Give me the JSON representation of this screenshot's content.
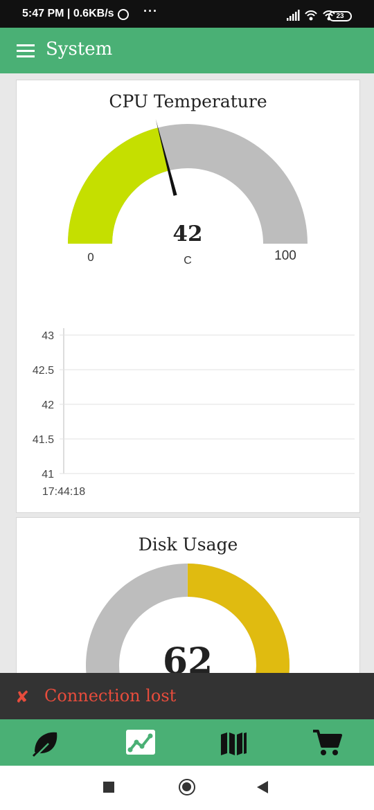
{
  "status_bar": {
    "time": "5:47 PM | 0.6KB/s",
    "dots": "···",
    "battery": "23",
    "icons": [
      "alarm-icon",
      "signal-icon",
      "wifi-icon",
      "battery-icon"
    ]
  },
  "app_bar": {
    "title": "System",
    "menu_icon": "hamburger-menu-icon"
  },
  "cpu": {
    "title": "CPU Temperature",
    "gauge": {
      "value": 42,
      "value_label": "42",
      "min": 0,
      "max": 100,
      "min_label": "0",
      "max_label": "100",
      "unit": "C",
      "fill_color": "#c5df00",
      "track_color": "#bdbdbd"
    }
  },
  "chart_data": {
    "type": "line",
    "title": "",
    "xlabel": "",
    "ylabel": "",
    "ylim": [
      41,
      43
    ],
    "y_ticks": [
      "43",
      "42.5",
      "42",
      "41.5",
      "41"
    ],
    "x_ticks": [
      "17:44:18"
    ],
    "series": [],
    "grid": true
  },
  "disk": {
    "title": "Disk Usage",
    "donut": {
      "value": 62,
      "value_label": "62",
      "max": 100,
      "fill_color": "#e0bb10",
      "track_color": "#bdbdbd"
    }
  },
  "toast": {
    "icon": "close-icon",
    "message": "Connection lost"
  },
  "bottom_nav": {
    "items": [
      "leaf-icon",
      "chart-icon",
      "map-icon",
      "cart-icon"
    ],
    "active": "chart-icon"
  },
  "system_nav": [
    "recents-icon",
    "home-icon",
    "back-icon"
  ]
}
